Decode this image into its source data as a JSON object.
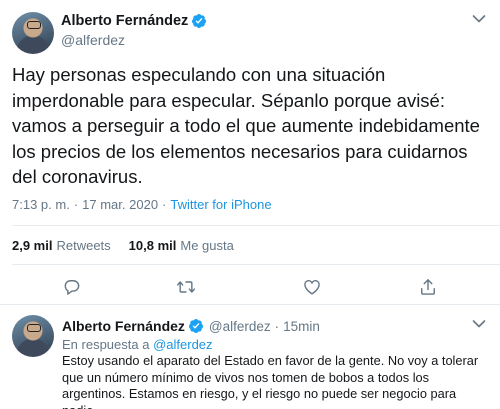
{
  "main_tweet": {
    "display_name": "Alberto Fernández",
    "handle": "@alferdez",
    "text": "Hay personas especulando con una situación imperdonable para especular. Sépanlo porque avisé: vamos a perseguir a todo el que aumente indebidamente los precios de los elementos necesarios para cuidarnos del coronavirus.",
    "time": "7:13 p. m.",
    "separator": "·",
    "date": "17 mar. 2020",
    "client": "Twitter for iPhone",
    "retweets_count": "2,9 mil",
    "retweets_label": "Retweets",
    "likes_count": "10,8 mil",
    "likes_label": "Me gusta"
  },
  "icons": {
    "verified": "verified-badge-icon",
    "more": "chevron-down-icon",
    "reply": "reply-bubble-icon",
    "retweet": "retweet-arrows-icon",
    "like": "heart-icon",
    "share": "share-upload-icon"
  },
  "colors": {
    "accent": "#1da1f2",
    "link": "#1b95e0",
    "muted": "#657786",
    "text": "#14171a",
    "divider": "#e6ecf0"
  },
  "reply_tweet": {
    "display_name": "Alberto Fernández",
    "handle": "@alferdez",
    "separator": "·",
    "time_ago": "15min",
    "in_reply_prefix": "En respuesta a",
    "in_reply_to": "@alferdez",
    "text": "Estoy usando el aparato del Estado en favor de la gente. No voy a tolerar que un número mínimo de vivos nos tomen de bobos a todos los argentinos. Estamos en riesgo, y el riesgo no puede ser negocio para nadie."
  }
}
